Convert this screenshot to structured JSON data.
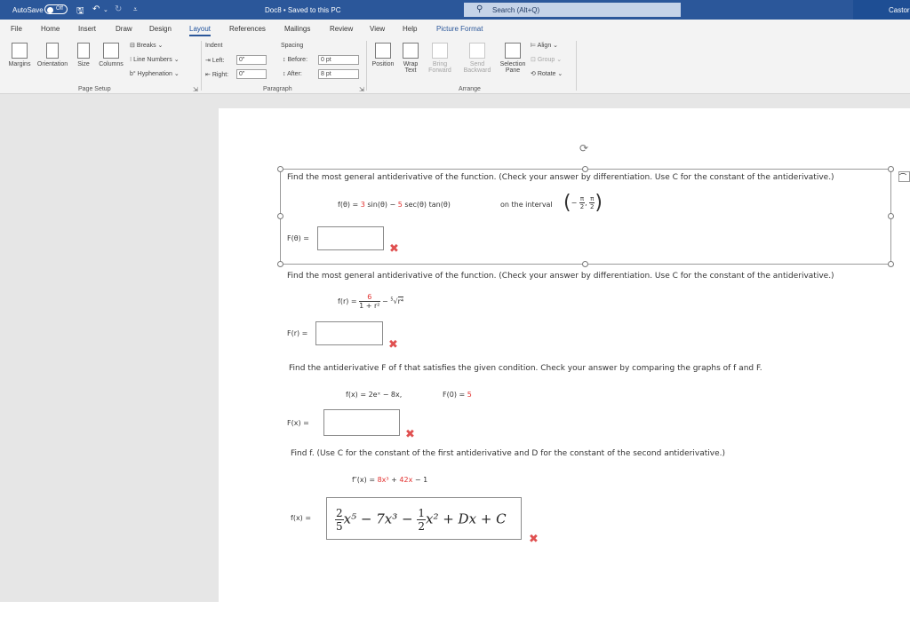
{
  "titlebar": {
    "autosave_label": "AutoSave",
    "autosave_state": "Off",
    "doc_title": "Doc8 • Saved to this PC",
    "search_placeholder": "Search (Alt+Q)",
    "user": "Castor"
  },
  "tabs": [
    "File",
    "Home",
    "Insert",
    "Draw",
    "Design",
    "Layout",
    "References",
    "Mailings",
    "Review",
    "View",
    "Help",
    "Picture Format"
  ],
  "active_tab": "Layout",
  "ribbon": {
    "page_setup": {
      "margins": "Margins",
      "orientation": "Orientation",
      "size": "Size",
      "columns": "Columns",
      "breaks": "Breaks",
      "line_numbers": "Line Numbers",
      "hyphenation": "Hyphenation",
      "group_label": "Page Setup"
    },
    "paragraph": {
      "indent_label": "Indent",
      "spacing_label": "Spacing",
      "left_label": "Left:",
      "left_value": "0\"",
      "right_label": "Right:",
      "right_value": "0\"",
      "before_label": "Before:",
      "before_value": "0 pt",
      "after_label": "After:",
      "after_value": "8 pt",
      "group_label": "Paragraph"
    },
    "arrange": {
      "position": "Position",
      "wrap_text_1": "Wrap",
      "wrap_text_2": "Text",
      "bring_forward_1": "Bring",
      "bring_forward_2": "Forward",
      "send_backward_1": "Send",
      "send_backward_2": "Backward",
      "selection_pane_1": "Selection",
      "selection_pane_2": "Pane",
      "align": "Align",
      "group": "Group",
      "rotate": "Rotate",
      "group_label": "Arrange"
    }
  },
  "doc": {
    "q1": {
      "prompt": "Find the most general antiderivative of the function. (Check your answer by differentiation. Use C for the constant of the antiderivative.)",
      "f_lhs": "f(θ) = ",
      "coef1": "3",
      "term1": " sin(θ) − ",
      "coef2": "5",
      "term2": " sec(θ) tan(θ)",
      "interval_label": "on the interval",
      "interval_minus": "−",
      "pi": "π",
      "two": "2",
      "answer_label": "F(θ) ="
    },
    "q2": {
      "prompt": "Find the most general antiderivative of the function. (Check your answer by differentiation. Use C for the constant of the antiderivative.)",
      "f_lhs": "f(r) = ",
      "numerator": "6",
      "denominator": "1 + r²",
      "minus": " − ",
      "root_index": "5",
      "radicand": "r⁴",
      "answer_label": "F(r) ="
    },
    "q3": {
      "prompt": "Find the antiderivative F of f that satisfies the given condition. Check your answer by comparing the graphs of f and F.",
      "f_expr": "f(x) = 2eˣ − 8x,",
      "cond_lhs": "F(0) = ",
      "cond_val": "5",
      "answer_label": "F(x) ="
    },
    "q4": {
      "prompt": "Find f. (Use C for the constant of the first antiderivative and D for the constant of the second antiderivative.)",
      "f_lhs": "f″(x) = ",
      "t1": "8x³",
      "plus": " + ",
      "t2": "42x",
      "t3": " − 1",
      "answer_label": "f(x) =",
      "answer_frac1_num": "2",
      "answer_frac1_den": "5",
      "answer_part1": "x⁵ − 7x³ − ",
      "answer_frac2_num": "1",
      "answer_frac2_den": "2",
      "answer_part2": "x² + Dx + C"
    },
    "wrong_mark": "✖"
  },
  "colors": {
    "accent": "#2b579a",
    "wrong": "#e05050",
    "red_value": "#e2302e"
  }
}
